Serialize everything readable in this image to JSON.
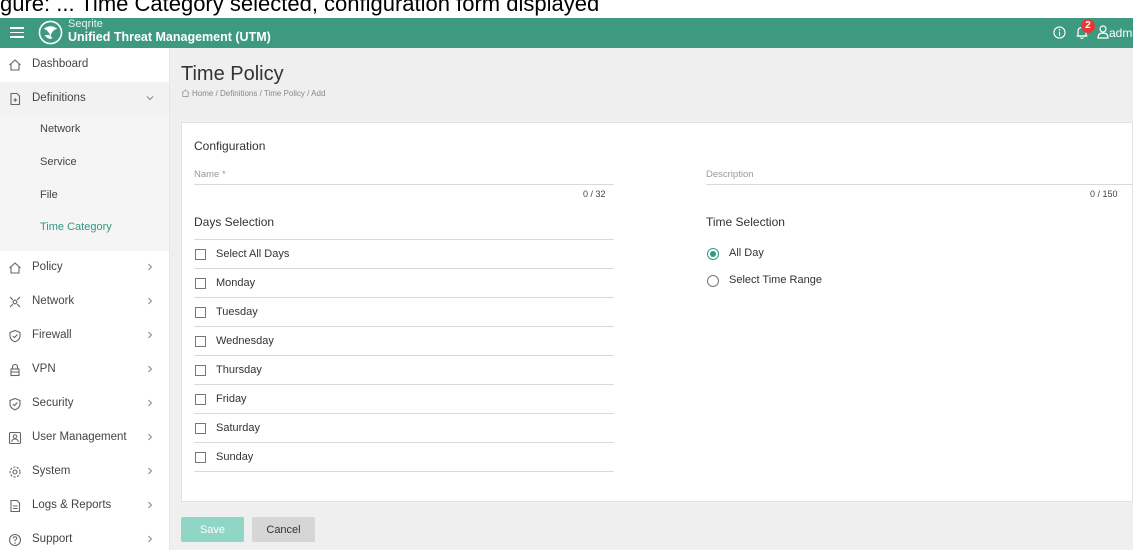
{
  "header": {
    "brand_top": "Seqrite",
    "brand_main": "Unified Threat Management (UTM)",
    "notification_count": "2",
    "user": "adm"
  },
  "sidebar": {
    "items": [
      {
        "label": "Dashboard",
        "icon": "home-icon"
      },
      {
        "label": "Definitions",
        "icon": "definitions-icon"
      },
      {
        "label": "Policy",
        "icon": "policy-icon"
      },
      {
        "label": "Network",
        "icon": "network-icon"
      },
      {
        "label": "Firewall",
        "icon": "firewall-shield-icon"
      },
      {
        "label": "VPN",
        "icon": "vpn-lock-icon"
      },
      {
        "label": "Security",
        "icon": "security-shield-icon"
      },
      {
        "label": "User Management",
        "icon": "user-management-icon"
      },
      {
        "label": "System",
        "icon": "system-gear-icon"
      },
      {
        "label": "Logs & Reports",
        "icon": "logs-reports-icon"
      },
      {
        "label": "Support",
        "icon": "support-help-icon"
      }
    ],
    "subitems": [
      "Network",
      "Service",
      "File",
      "Time Category"
    ],
    "current_subitem": "Time Category"
  },
  "page": {
    "title": "Time Policy",
    "breadcrumb": "Home / Definitions / Time Policy / Add"
  },
  "form": {
    "configuration_title": "Configuration",
    "name_label": "Name *",
    "name_value": "",
    "name_counter": "0 / 32",
    "description_label": "Description",
    "description_value": "",
    "description_counter": "0 / 150",
    "days_title": "Days Selection",
    "days": [
      "Select All Days",
      "Monday",
      "Tuesday",
      "Wednesday",
      "Thursday",
      "Friday",
      "Saturday",
      "Sunday"
    ],
    "time_title": "Time Selection",
    "time_options": [
      {
        "label": "All Day",
        "selected": true
      },
      {
        "label": "Select Time Range",
        "selected": false
      }
    ]
  },
  "buttons": {
    "save": "Save",
    "cancel": "Cancel"
  },
  "colors": {
    "topbar": "#3d9a80",
    "accent": "#2e9a80",
    "save_button": "#8fd6c7",
    "badge": "#e53935"
  }
}
